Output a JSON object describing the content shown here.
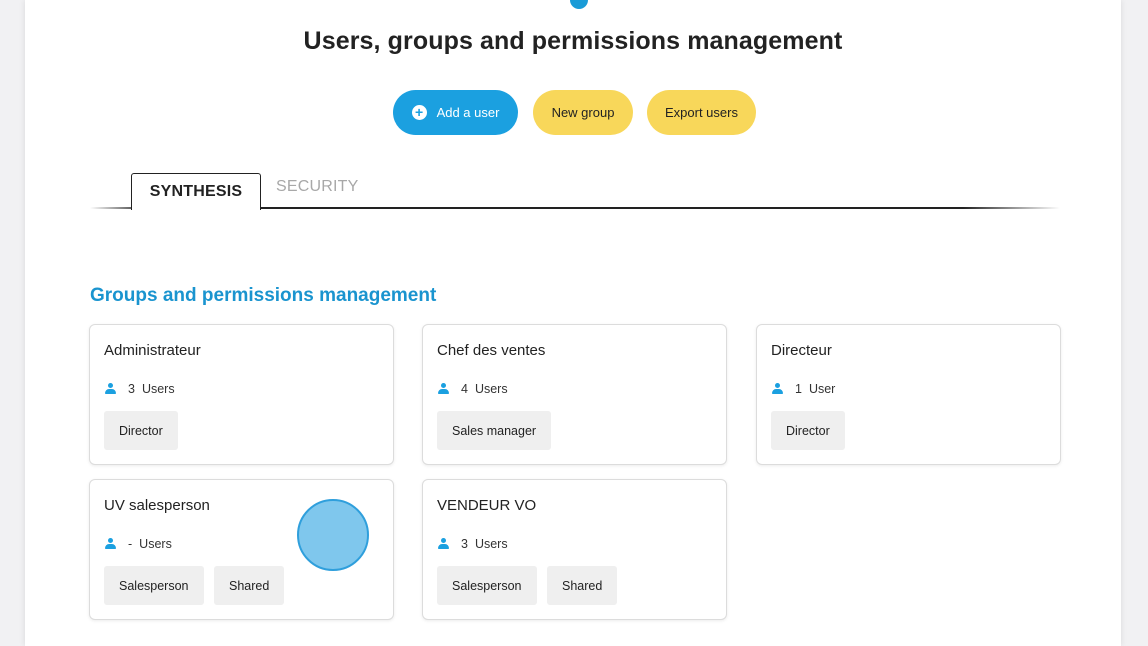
{
  "page": {
    "title": "Users, groups and permissions management"
  },
  "actions": {
    "add_user": "Add a user",
    "new_group": "New group",
    "export_users": "Export users"
  },
  "tabs": [
    {
      "label": "SYNTHESIS",
      "active": true
    },
    {
      "label": "SECURITY",
      "active": false
    }
  ],
  "section": {
    "title": "Groups and permissions management"
  },
  "groups": [
    {
      "name": "Administrateur",
      "count": "3",
      "unit": "Users",
      "tags": [
        "Director"
      ]
    },
    {
      "name": "Chef des ventes",
      "count": "4",
      "unit": "Users",
      "tags": [
        "Sales manager"
      ]
    },
    {
      "name": "Directeur",
      "count": "1",
      "unit": "User",
      "tags": [
        "Director"
      ]
    },
    {
      "name": "UV salesperson",
      "count": "-",
      "unit": "Users",
      "tags": [
        "Salesperson",
        "Shared"
      ]
    },
    {
      "name": "VENDEUR VO",
      "count": "3",
      "unit": "Users",
      "tags": [
        "Salesperson",
        "Shared"
      ]
    }
  ],
  "icons": {
    "user": "user-icon",
    "add": "plus-circle-icon"
  },
  "colors": {
    "primary_blue": "#1ba0e0",
    "accent_yellow": "#f8d75a",
    "section_title": "#1a94cf"
  }
}
